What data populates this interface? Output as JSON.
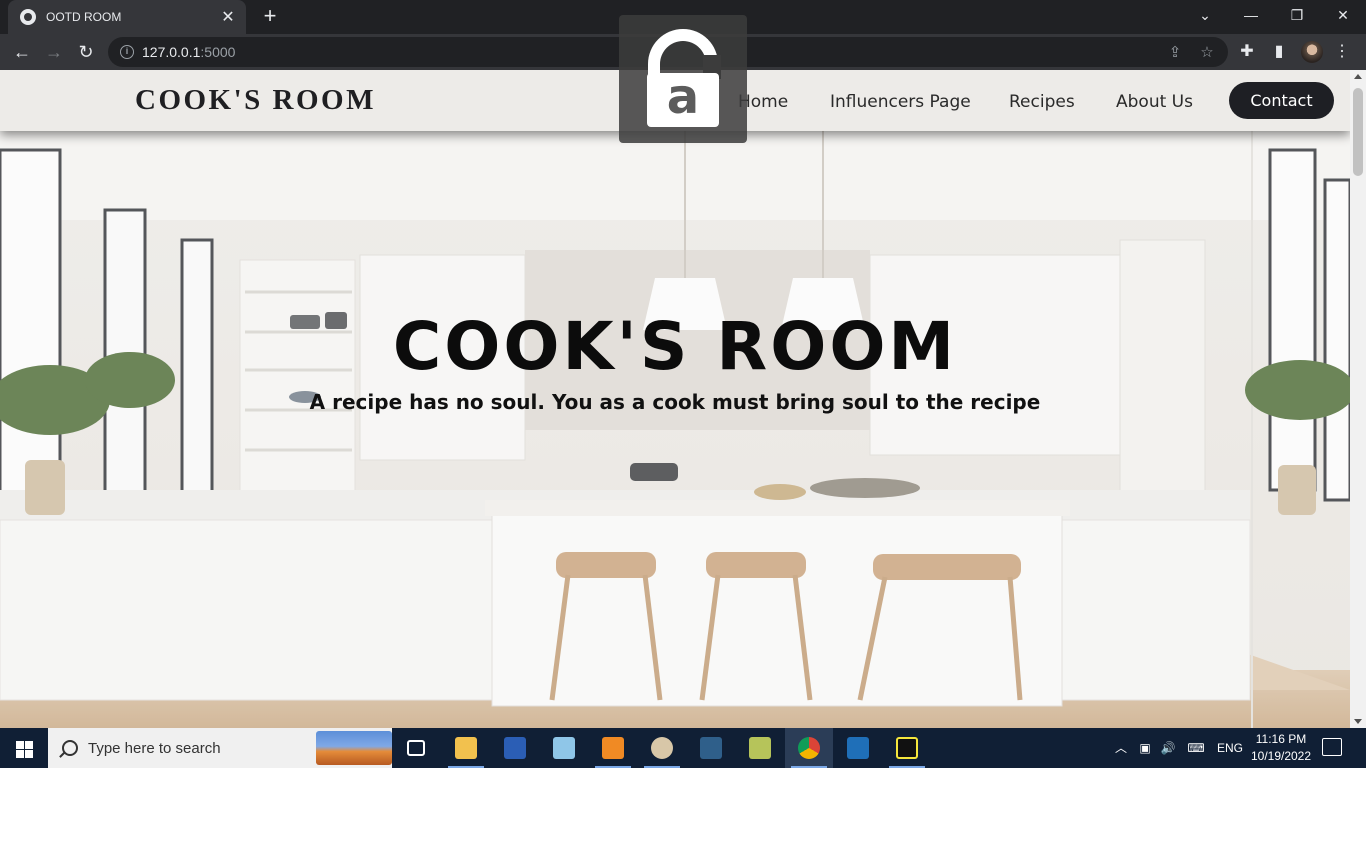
{
  "browser": {
    "tab_title": "OOTD ROOM",
    "tab_close": "✕",
    "new_tab": "+",
    "url_host": "127.0.0.1",
    "url_port": ":5000",
    "window_controls": {
      "chevron": "⌄",
      "minimize": "—",
      "restore": "❐",
      "close": "✕"
    }
  },
  "site": {
    "brand": "COOK'S ROOM",
    "nav": [
      "Home",
      "Influencers Page",
      "Recipes",
      "About Us"
    ],
    "contact_label": "Contact",
    "hero_title": "COOK'S ROOM",
    "hero_subtitle": "A recipe has no soul. You as a cook must bring soul to the recipe",
    "lock_letter": "a"
  },
  "taskbar": {
    "search_placeholder": "Type here to search",
    "language": "ENG",
    "time": "11:16 PM",
    "date": "10/19/2022",
    "apps": [
      "task-view",
      "file-explorer",
      "word",
      "notepad",
      "sublime-text",
      "paint",
      "mysql-workbench",
      "visual-paradigm",
      "chrome",
      "virtualbox",
      "pycharm"
    ]
  },
  "colors": {
    "nav_bg": "#ECEAE7",
    "contact_bg": "#1E1F24",
    "taskbar_bg": "#101F35",
    "chrome_dark": "#202124"
  }
}
